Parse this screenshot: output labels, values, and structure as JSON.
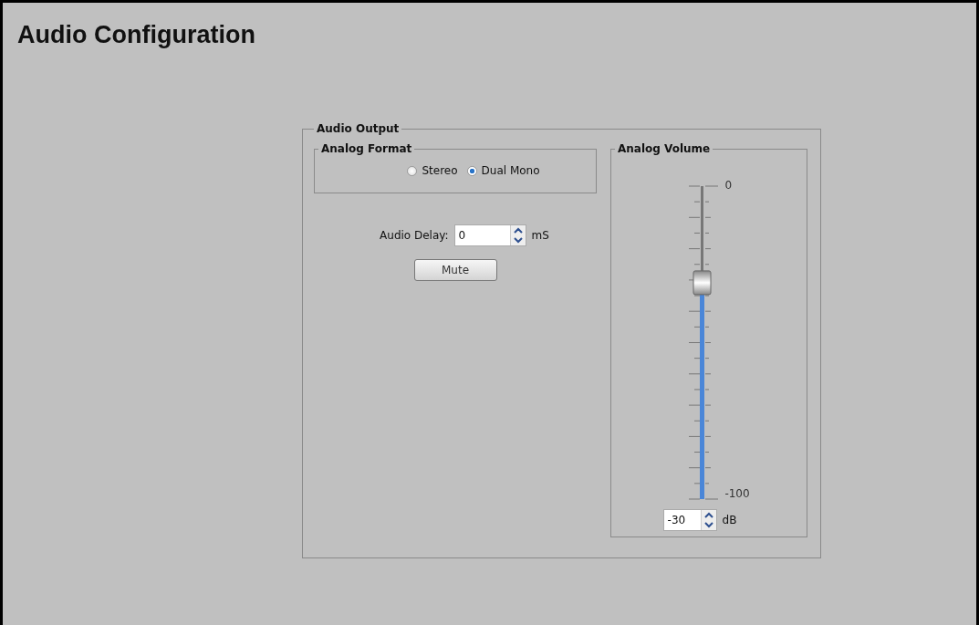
{
  "title": "Audio Configuration",
  "audio_output": {
    "legend": "Audio Output",
    "analog_format": {
      "legend": "Analog Format",
      "options": [
        {
          "label": "Stereo",
          "selected": false
        },
        {
          "label": "Dual Mono",
          "selected": true
        }
      ]
    },
    "audio_delay": {
      "label": "Audio Delay:",
      "value": "0",
      "unit": "mS"
    },
    "mute_button": "Mute",
    "analog_volume": {
      "legend": "Analog Volume",
      "max_label": "0",
      "min_label": "-100",
      "level": 0.7,
      "value": "-30",
      "unit": "dB"
    }
  }
}
